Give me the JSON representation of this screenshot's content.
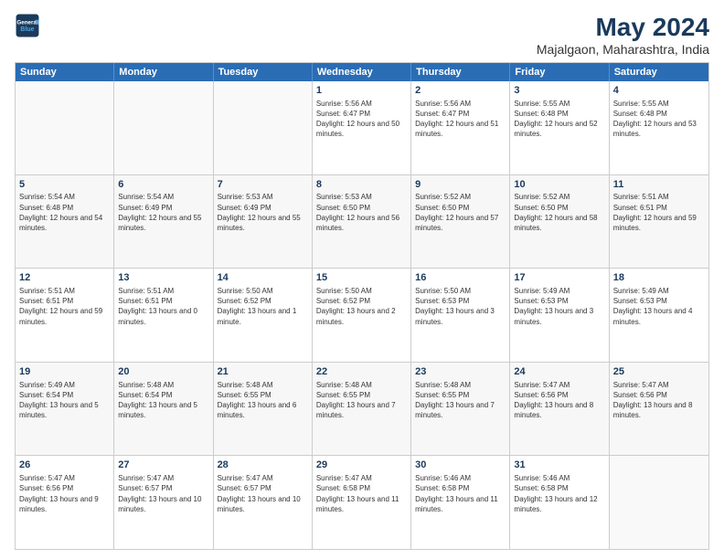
{
  "logo": {
    "line1": "General",
    "line2": "Blue"
  },
  "title": "May 2024",
  "subtitle": "Majalgaon, Maharashtra, India",
  "days": [
    "Sunday",
    "Monday",
    "Tuesday",
    "Wednesday",
    "Thursday",
    "Friday",
    "Saturday"
  ],
  "rows": [
    [
      {
        "day": "",
        "content": ""
      },
      {
        "day": "",
        "content": ""
      },
      {
        "day": "",
        "content": ""
      },
      {
        "day": "1",
        "content": "Sunrise: 5:56 AM\nSunset: 6:47 PM\nDaylight: 12 hours and 50 minutes."
      },
      {
        "day": "2",
        "content": "Sunrise: 5:56 AM\nSunset: 6:47 PM\nDaylight: 12 hours and 51 minutes."
      },
      {
        "day": "3",
        "content": "Sunrise: 5:55 AM\nSunset: 6:48 PM\nDaylight: 12 hours and 52 minutes."
      },
      {
        "day": "4",
        "content": "Sunrise: 5:55 AM\nSunset: 6:48 PM\nDaylight: 12 hours and 53 minutes."
      }
    ],
    [
      {
        "day": "5",
        "content": "Sunrise: 5:54 AM\nSunset: 6:48 PM\nDaylight: 12 hours and 54 minutes."
      },
      {
        "day": "6",
        "content": "Sunrise: 5:54 AM\nSunset: 6:49 PM\nDaylight: 12 hours and 55 minutes."
      },
      {
        "day": "7",
        "content": "Sunrise: 5:53 AM\nSunset: 6:49 PM\nDaylight: 12 hours and 55 minutes."
      },
      {
        "day": "8",
        "content": "Sunrise: 5:53 AM\nSunset: 6:50 PM\nDaylight: 12 hours and 56 minutes."
      },
      {
        "day": "9",
        "content": "Sunrise: 5:52 AM\nSunset: 6:50 PM\nDaylight: 12 hours and 57 minutes."
      },
      {
        "day": "10",
        "content": "Sunrise: 5:52 AM\nSunset: 6:50 PM\nDaylight: 12 hours and 58 minutes."
      },
      {
        "day": "11",
        "content": "Sunrise: 5:51 AM\nSunset: 6:51 PM\nDaylight: 12 hours and 59 minutes."
      }
    ],
    [
      {
        "day": "12",
        "content": "Sunrise: 5:51 AM\nSunset: 6:51 PM\nDaylight: 12 hours and 59 minutes."
      },
      {
        "day": "13",
        "content": "Sunrise: 5:51 AM\nSunset: 6:51 PM\nDaylight: 13 hours and 0 minutes."
      },
      {
        "day": "14",
        "content": "Sunrise: 5:50 AM\nSunset: 6:52 PM\nDaylight: 13 hours and 1 minute."
      },
      {
        "day": "15",
        "content": "Sunrise: 5:50 AM\nSunset: 6:52 PM\nDaylight: 13 hours and 2 minutes."
      },
      {
        "day": "16",
        "content": "Sunrise: 5:50 AM\nSunset: 6:53 PM\nDaylight: 13 hours and 3 minutes."
      },
      {
        "day": "17",
        "content": "Sunrise: 5:49 AM\nSunset: 6:53 PM\nDaylight: 13 hours and 3 minutes."
      },
      {
        "day": "18",
        "content": "Sunrise: 5:49 AM\nSunset: 6:53 PM\nDaylight: 13 hours and 4 minutes."
      }
    ],
    [
      {
        "day": "19",
        "content": "Sunrise: 5:49 AM\nSunset: 6:54 PM\nDaylight: 13 hours and 5 minutes."
      },
      {
        "day": "20",
        "content": "Sunrise: 5:48 AM\nSunset: 6:54 PM\nDaylight: 13 hours and 5 minutes."
      },
      {
        "day": "21",
        "content": "Sunrise: 5:48 AM\nSunset: 6:55 PM\nDaylight: 13 hours and 6 minutes."
      },
      {
        "day": "22",
        "content": "Sunrise: 5:48 AM\nSunset: 6:55 PM\nDaylight: 13 hours and 7 minutes."
      },
      {
        "day": "23",
        "content": "Sunrise: 5:48 AM\nSunset: 6:55 PM\nDaylight: 13 hours and 7 minutes."
      },
      {
        "day": "24",
        "content": "Sunrise: 5:47 AM\nSunset: 6:56 PM\nDaylight: 13 hours and 8 minutes."
      },
      {
        "day": "25",
        "content": "Sunrise: 5:47 AM\nSunset: 6:56 PM\nDaylight: 13 hours and 8 minutes."
      }
    ],
    [
      {
        "day": "26",
        "content": "Sunrise: 5:47 AM\nSunset: 6:56 PM\nDaylight: 13 hours and 9 minutes."
      },
      {
        "day": "27",
        "content": "Sunrise: 5:47 AM\nSunset: 6:57 PM\nDaylight: 13 hours and 10 minutes."
      },
      {
        "day": "28",
        "content": "Sunrise: 5:47 AM\nSunset: 6:57 PM\nDaylight: 13 hours and 10 minutes."
      },
      {
        "day": "29",
        "content": "Sunrise: 5:47 AM\nSunset: 6:58 PM\nDaylight: 13 hours and 11 minutes."
      },
      {
        "day": "30",
        "content": "Sunrise: 5:46 AM\nSunset: 6:58 PM\nDaylight: 13 hours and 11 minutes."
      },
      {
        "day": "31",
        "content": "Sunrise: 5:46 AM\nSunset: 6:58 PM\nDaylight: 13 hours and 12 minutes."
      },
      {
        "day": "",
        "content": ""
      }
    ]
  ]
}
